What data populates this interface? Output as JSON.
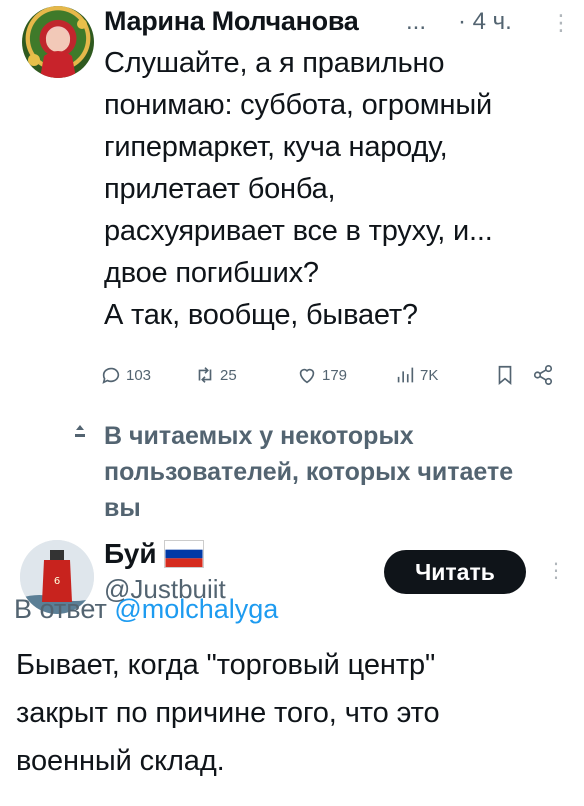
{
  "tweet": {
    "author": "Марина Молчанова",
    "ellipsis": "...",
    "time": "· 4 ч.",
    "more": "⋮",
    "body_lines": [
      "Слушайте, а я правильно",
      "понимаю: суббота, огромный",
      "гипермаркет, куча народу,",
      "прилетает бонба,",
      "расхуяривает все в труху, и...",
      "двое погибших?",
      "А так, вообще, бывает?"
    ],
    "actions": {
      "replies": "103",
      "retweets": "25",
      "likes": "179",
      "views": "7K"
    }
  },
  "context": {
    "icon": "person-arrow-icon",
    "lines": [
      "В читаемых у некоторых",
      "пользователей, которых читаете",
      "вы"
    ]
  },
  "reply": {
    "name": "Буй",
    "handle": "@Justbuiit",
    "follow_label": "Читать",
    "more": "⋮",
    "reply_to_prefix": "В ответ ",
    "reply_to_mention": "@molchalyga",
    "body_lines": [
      "Бывает, когда \"торговый центр\"",
      "закрыт по причине того, что это",
      "военный склад."
    ]
  },
  "colors": {
    "text": "#0f1419",
    "secondary": "#536471",
    "link": "#1d9bf0",
    "button": "#0f1419"
  }
}
